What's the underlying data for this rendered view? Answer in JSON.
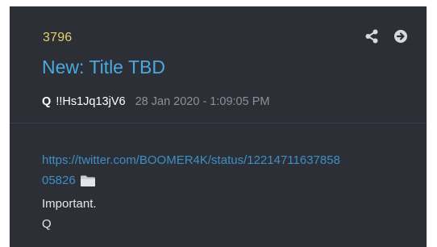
{
  "post": {
    "number": "3796",
    "title": "New: Title TBD",
    "author": "Q",
    "tripcode": "!!Hs1Jq13jV6",
    "date": "28 Jan 2020 - 1:09:05 PM",
    "link_line1": "https://twitter.com/BOOMER4K/status/12214711637858",
    "link_line2": "05826",
    "body_lines": [
      "Important.",
      "Q"
    ]
  },
  "icons": {
    "share": "share-icon",
    "goto": "arrow-circle-right-icon",
    "folder": "folder-icon"
  },
  "colors": {
    "card_bg": "#2d2f36",
    "post_number": "#e3d26a",
    "title": "#4aa9e0",
    "link": "#3d8fc6",
    "date": "#8d9098"
  }
}
